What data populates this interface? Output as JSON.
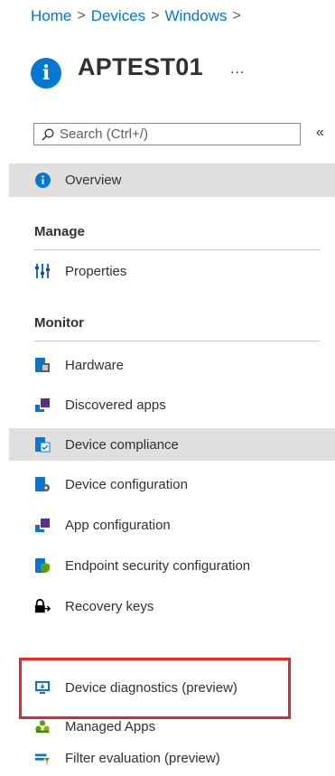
{
  "breadcrumb": {
    "items": [
      "Home",
      "Devices",
      "Windows"
    ],
    "separator": ">"
  },
  "header": {
    "title": "APTEST01",
    "more": "..."
  },
  "search": {
    "placeholder": "Search (Ctrl+/)",
    "collapse": "«"
  },
  "nav": {
    "overview": {
      "label": "Overview",
      "icon": "info-icon"
    },
    "manage_header": "Manage",
    "properties": {
      "label": "Properties",
      "icon": "properties-icon"
    },
    "monitor_header": "Monitor",
    "items": [
      {
        "label": "Hardware",
        "icon": "hardware-icon"
      },
      {
        "label": "Discovered apps",
        "icon": "discovered-apps-icon"
      },
      {
        "label": "Device compliance",
        "icon": "device-compliance-icon"
      },
      {
        "label": "Device configuration",
        "icon": "device-configuration-icon"
      },
      {
        "label": "App configuration",
        "icon": "app-configuration-icon"
      },
      {
        "label": "Endpoint security configuration",
        "icon": "endpoint-security-icon"
      },
      {
        "label": "Recovery keys",
        "icon": "recovery-keys-icon"
      },
      {
        "label": "Device diagnostics (preview)",
        "icon": "device-diagnostics-icon"
      },
      {
        "label": "Managed Apps",
        "icon": "managed-apps-icon"
      },
      {
        "label": "Filter evaluation (preview)",
        "icon": "filter-evaluation-icon"
      }
    ]
  },
  "colors": {
    "accent": "#0078d4",
    "selected_bg": "#e1dfdd",
    "highlight_border": "#e8272b"
  }
}
